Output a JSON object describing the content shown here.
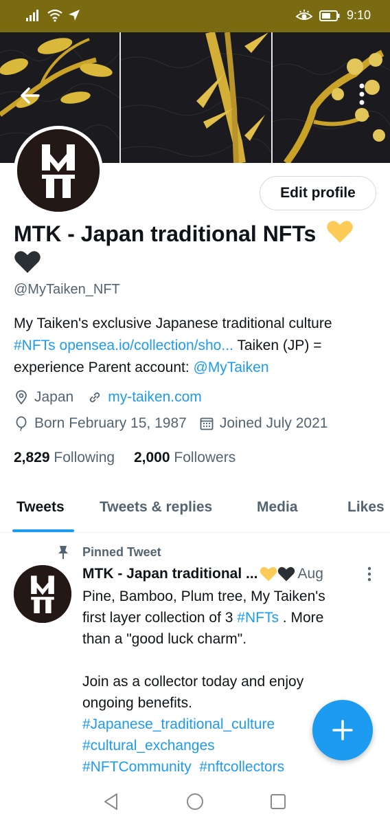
{
  "status_bar": {
    "time": "9:10",
    "icons": [
      "signal-icon",
      "wifi-icon",
      "location-arrow-icon",
      "eye-comfort-icon",
      "battery-icon"
    ],
    "background_color": "#7a6a10"
  },
  "header": {
    "back_icon": "back-arrow-icon",
    "more_icon": "more-vertical-icon",
    "banner_colors": [
      "#16161a",
      "#d4af37"
    ]
  },
  "profile": {
    "edit_label": "Edit profile",
    "name": "MTK - Japan traditional NFTs",
    "name_emojis": [
      "yellow-heart",
      "black-heart"
    ],
    "handle": "@MyTaiken_NFT",
    "bio": {
      "line1": "My Taiken's exclusive  Japanese traditional culture",
      "hashtag": "#NFTs",
      "url": "opensea.io/collection/sho...",
      "text2": " Taiken (JP) = ",
      "text3": "experience  Parent account: ",
      "mention": "@MyTaiken"
    },
    "location": "Japan",
    "website": "my-taiken.com",
    "born": "Born February 15, 1987",
    "joined": "Joined July 2021",
    "following_count": "2,829",
    "following_label": "Following",
    "followers_count": "2,000",
    "followers_label": "Followers"
  },
  "tabs": [
    {
      "label": "Tweets",
      "active": true
    },
    {
      "label": "Tweets & replies",
      "active": false
    },
    {
      "label": "Media",
      "active": false
    },
    {
      "label": "Likes",
      "active": false
    }
  ],
  "pinned_tweet": {
    "pinned_label": "Pinned Tweet",
    "author": "MTK - Japan traditional ...",
    "date": "Aug",
    "body": {
      "line1": "Pine, Bamboo, Plum tree, My Taiken's",
      "line2_text": "first layer collection of 3 ",
      "line2_hashtag": "#NFTs",
      "line2_after": " . More",
      "line3": "than a \"good luck charm\".",
      "line4": "Join as a collector today and enjoy",
      "line5": "ongoing benefits.",
      "hashtag1": "#Japanese_traditional_culture",
      "hashtag2": "#cultural_exchanges",
      "hashtag3": "#NFTCommunity",
      "hashtag4": "#nftcollectors"
    }
  },
  "fab": {
    "icon": "plus-icon",
    "color": "#1d9bf0"
  },
  "nav_bar": {
    "icons": [
      "back-triangle-icon",
      "home-circle-icon",
      "recents-square-icon"
    ]
  },
  "accent_color": "#1d9bf0"
}
